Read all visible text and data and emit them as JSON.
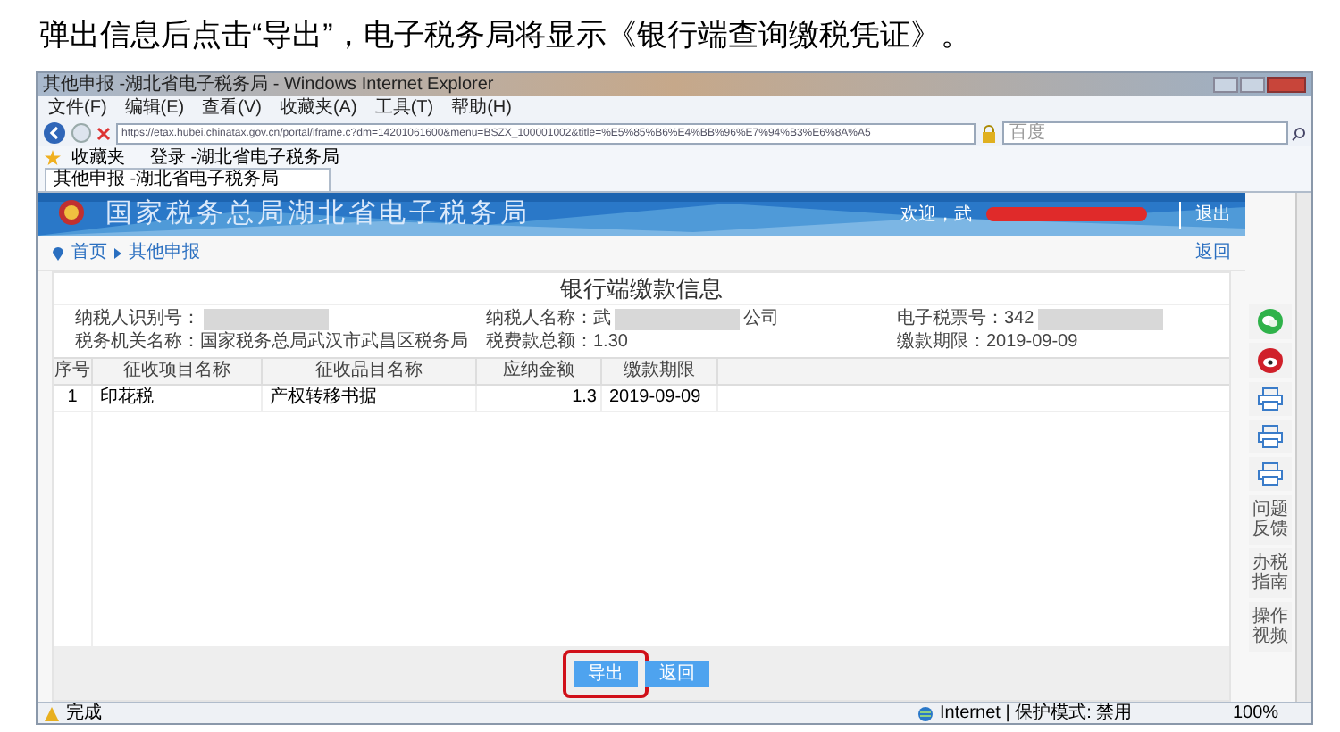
{
  "caption": "弹出信息后点击“导出”，电子税务局将显示《银行端查询缴税凭证》。",
  "window": {
    "title": "其他申报 -湖北省电子税务局 - Windows Internet Explorer"
  },
  "menu": [
    "文件(F)",
    "编辑(E)",
    "查看(V)",
    "收藏夹(A)",
    "工具(T)",
    "帮助(H)"
  ],
  "address": {
    "url": "https://etax.hubei.chinatax.gov.cn/portal/iframe.c?dm=14201061600&menu=BSZX_100001002&title=%E5%85%B6%E4%BB%96%E7%94%B3%E6%8A%A5"
  },
  "search": {
    "placeholder": "百度"
  },
  "favorites": {
    "label": "收藏夹",
    "items": [
      "登录 -湖北省电子税务局"
    ]
  },
  "tabs": [
    {
      "label": "其他申报 -湖北省电子税务局",
      "selected": true
    }
  ],
  "banner": {
    "title": "国家税务总局湖北省电子税务局",
    "welcome": "欢迎，武",
    "redacted": true,
    "logout": "退出"
  },
  "breadcrumb": [
    "首页",
    "其他申报"
  ],
  "back_link": "返回",
  "heading": "银行端缴款信息",
  "info": [
    {
      "text": "纳税人识别号：",
      "redacted": true
    },
    {
      "text": "纳税人名称：武",
      "redacted": true,
      "suffix": "公司"
    },
    {
      "text": "电子税票号：342",
      "redacted": true
    },
    {
      "text": "税务机关名称：国家税务总局武汉市武昌区税务局",
      "redacted": false
    },
    {
      "text": "税费款总额：1.30",
      "redacted": false
    },
    {
      "text": "缴款期限：2019-09-09",
      "redacted": false
    }
  ],
  "table": {
    "columns": [
      "序号",
      "征收项目名称",
      "征收品目名称",
      "应纳金额",
      "缴款期限"
    ],
    "rows": [
      [
        "1",
        "印花税",
        "产权转移书据",
        "1.3",
        "2019-09-09"
      ]
    ]
  },
  "buttons": [
    {
      "label": "导出",
      "highlighted": true
    },
    {
      "label": "返回",
      "highlighted": false
    }
  ],
  "side_tools": [
    {
      "kind": "wechat"
    },
    {
      "kind": "weibo"
    },
    {
      "kind": "print"
    },
    {
      "kind": "print"
    },
    {
      "kind": "print"
    },
    {
      "kind": "text",
      "label": "问题反馈"
    },
    {
      "kind": "text",
      "label": "办税指南"
    },
    {
      "kind": "text",
      "label": "操作视频"
    }
  ],
  "status": {
    "left": "完成",
    "zone": "Internet | 保护模式: 禁用",
    "zoom": "100%"
  }
}
